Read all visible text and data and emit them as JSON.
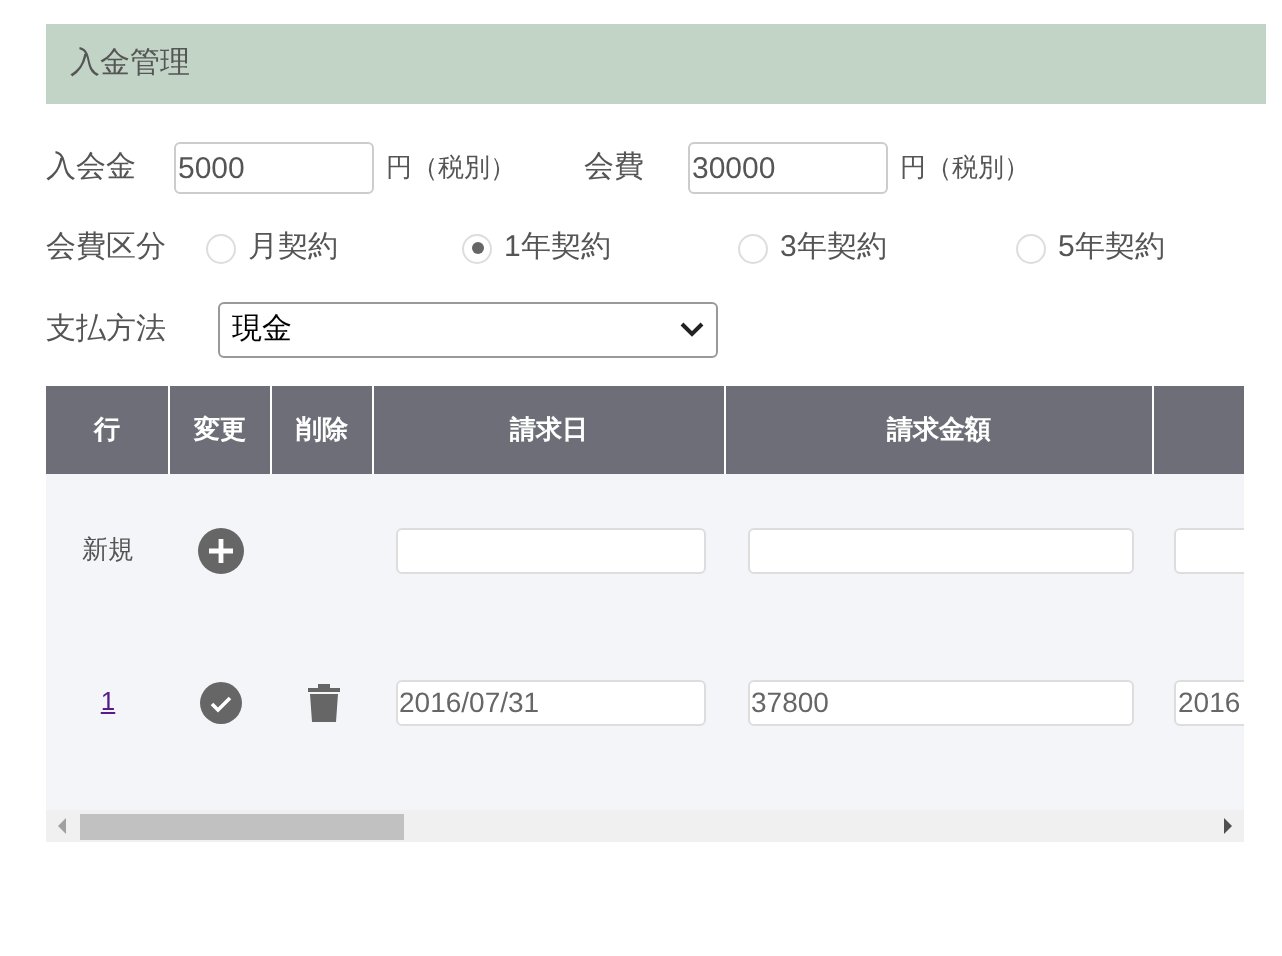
{
  "title": "入金管理",
  "fees": [
    {
      "label": "入会金",
      "value": "5000",
      "unit": "円（税別）"
    },
    {
      "label": "会費",
      "value": "30000",
      "unit": "円（税別）"
    }
  ],
  "plan": {
    "label": "会費区分",
    "options": [
      {
        "label": "月契約",
        "selected": false
      },
      {
        "label": "1年契約",
        "selected": true
      },
      {
        "label": "3年契約",
        "selected": false
      },
      {
        "label": "5年契約",
        "selected": false
      }
    ]
  },
  "payment": {
    "label": "支払方法",
    "value": "現金"
  },
  "table": {
    "columns": [
      "行",
      "変更",
      "削除",
      "請求日",
      "請求金額"
    ],
    "new_row": {
      "label": "新規"
    },
    "rows": [
      {
        "row": "1",
        "date": "2016/07/31",
        "amount": "37800",
        "column_6": "2016"
      }
    ]
  }
}
